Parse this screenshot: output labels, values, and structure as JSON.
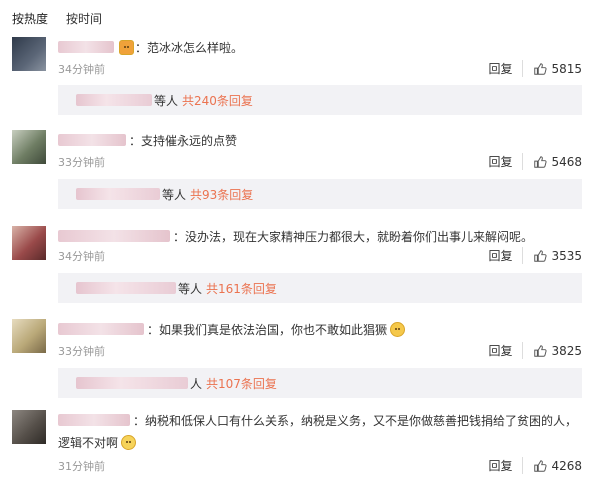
{
  "sort": {
    "hot": "按热度",
    "time": "按时间"
  },
  "actions": {
    "reply": "回复"
  },
  "comments": [
    {
      "text": "：范冰冰怎么样啦。",
      "line2": "",
      "time": "34分钟前",
      "likes": "5815",
      "reply_prefix": "等人",
      "reply_link": "共240条回复",
      "avatar_color": "#4a5566"
    },
    {
      "text": "：支持催永远的点赞",
      "line2": "",
      "time": "33分钟前",
      "likes": "5468",
      "reply_prefix": "等人",
      "reply_link": "共93条回复",
      "avatar_color": "#7d8b78"
    },
    {
      "text": "：没办法，现在大家精神压力都很大，就盼着你们出事儿来解闷呢。",
      "line2": "",
      "time": "34分钟前",
      "likes": "3535",
      "reply_prefix": "等人",
      "reply_link": "共161条回复",
      "avatar_color": "#9a4a4a"
    },
    {
      "text": "：如果我们真是依法治国，你也不敢如此猖獗",
      "line2": "",
      "time": "33分钟前",
      "likes": "3825",
      "reply_prefix": "人",
      "reply_link": "共107条回复",
      "avatar_color": "#b9a878"
    },
    {
      "text": "：纳税和低保人口有什么关系，纳税是义务，又不是你做慈善把钱捐给了贫困的人，",
      "line2": "逻辑不对啊",
      "time": "31分钟前",
      "likes": "4268",
      "reply_prefix": "",
      "reply_link": "",
      "avatar_color": "#56504a"
    }
  ]
}
